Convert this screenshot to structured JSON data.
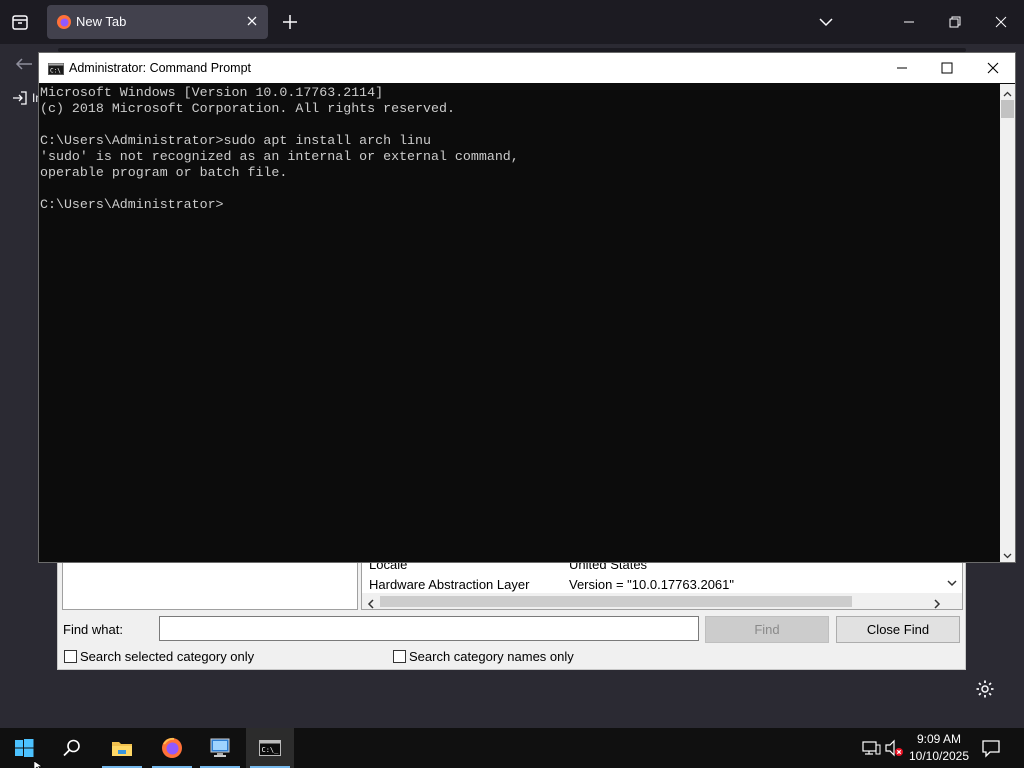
{
  "browser": {
    "tab_title": "New Tab",
    "bookmark_import_label": "Im"
  },
  "cmd": {
    "title": "Administrator: Command Prompt",
    "lines": [
      "Microsoft Windows [Version 10.0.17763.2114]",
      "(c) 2018 Microsoft Corporation. All rights reserved.",
      "",
      "C:\\Users\\Administrator>sudo apt install arch linu",
      "'sudo' is not recognized as an internal or external command,",
      "operable program or batch file.",
      "",
      "C:\\Users\\Administrator>"
    ]
  },
  "sysinfo": {
    "rows": [
      {
        "item": "Locale",
        "value": "United States"
      },
      {
        "item": "Hardware Abstraction Layer",
        "value": "Version = \"10.0.17763.2061\""
      }
    ],
    "find_label": "Find what:",
    "find_value": "",
    "find_button": "Find",
    "close_find_button": "Close Find",
    "search_selected_label": "Search selected category only",
    "search_names_label": "Search category names only"
  },
  "taskbar": {
    "time": "9:09 AM",
    "date": "10/10/2025"
  },
  "colors": {
    "console_bg": "#0c0c0c",
    "console_text": "#cccccc",
    "browser_bg": "#2b2a33",
    "taskbar_bg": "#101010",
    "taskbar_accent": "#76b9ed"
  }
}
